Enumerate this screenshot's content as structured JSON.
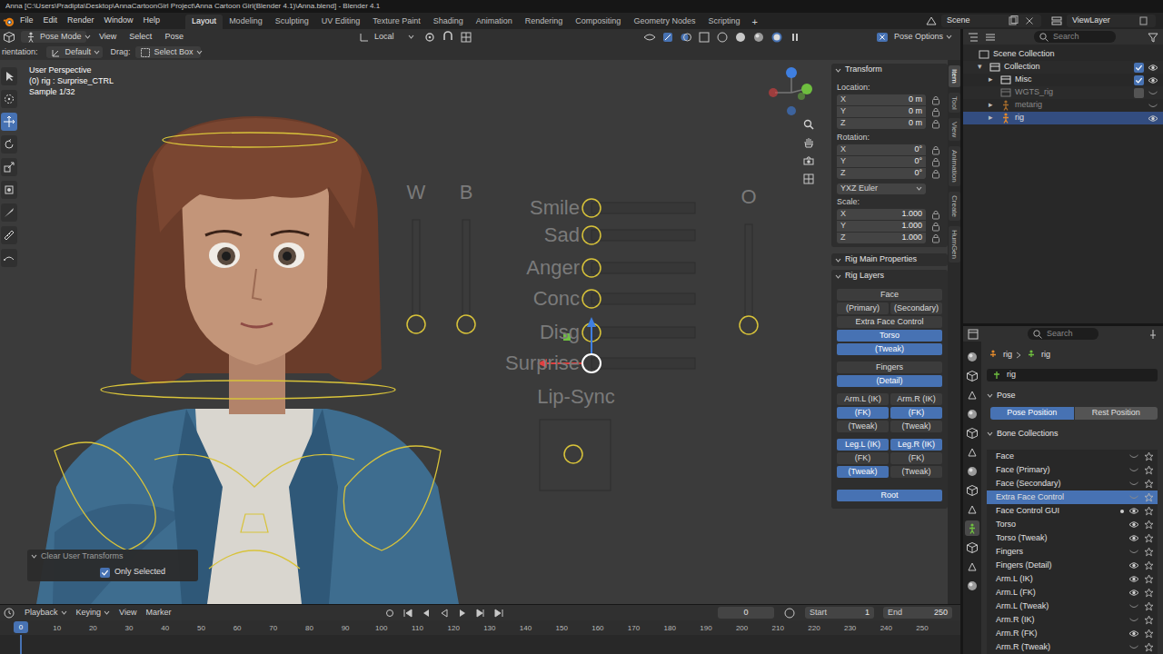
{
  "window": {
    "title": "Anna [C:\\Users\\Pradipta\\Desktop\\AnnaCartoonGirl Project\\Anna Cartoon Girl(Blender 4.1)\\Anna.blend] - Blender 4.1"
  },
  "menu": [
    "File",
    "Edit",
    "Render",
    "Window",
    "Help"
  ],
  "workspaces": [
    {
      "label": "Layout",
      "selected": true
    },
    {
      "label": "Modeling",
      "selected": false
    },
    {
      "label": "Sculpting",
      "selected": false
    },
    {
      "label": "UV Editing",
      "selected": false
    },
    {
      "label": "Texture Paint",
      "selected": false
    },
    {
      "label": "Shading",
      "selected": false
    },
    {
      "label": "Animation",
      "selected": false
    },
    {
      "label": "Rendering",
      "selected": false
    },
    {
      "label": "Compositing",
      "selected": false
    },
    {
      "label": "Geometry Nodes",
      "selected": false
    },
    {
      "label": "Scripting",
      "selected": false
    }
  ],
  "add_workspace": "+",
  "scene": "Scene",
  "view_layer": "ViewLayer",
  "viewport_header": {
    "mode": "Pose Mode",
    "menus": [
      "View",
      "Select",
      "Pose"
    ],
    "transform_space": "Local",
    "pose_options": "Pose Options"
  },
  "tool_settings": {
    "orientation_label": "rientation:",
    "orientation": "Default",
    "drag_label": "Drag:",
    "drag": "Select Box"
  },
  "viewport": {
    "info": [
      "User Perspective",
      "(0) rig : Surprise_CTRL",
      "Sample 1/32"
    ],
    "tools": [
      {
        "selected": false
      },
      {
        "selected": false
      },
      {
        "selected": true
      },
      {
        "selected": false
      },
      {
        "selected": false
      },
      {
        "selected": false
      },
      {
        "selected": false
      },
      {
        "selected": false
      },
      {
        "selected": false
      }
    ],
    "face_sliders": [
      {
        "label": "Smile",
        "selected": false
      },
      {
        "label": "Sad",
        "selected": false
      },
      {
        "label": "Anger",
        "selected": false
      },
      {
        "label": "Conc",
        "selected": false
      },
      {
        "label": "Disg",
        "selected": false
      },
      {
        "label": "Surprise",
        "selected": true
      }
    ],
    "lip_sync": "Lip-Sync",
    "vertical_controls": [
      {
        "label": "W"
      },
      {
        "label": "B"
      },
      {
        "label": "O"
      }
    ]
  },
  "operator_panel": {
    "title": "Clear User Transforms",
    "option": {
      "label": "Only Selected",
      "checked": true
    }
  },
  "sidebar": {
    "tabs": [
      {
        "label": "Item",
        "selected": true
      },
      {
        "label": "Tool",
        "selected": false
      },
      {
        "label": "View",
        "selected": false
      },
      {
        "label": "Animation",
        "selected": false
      },
      {
        "label": "Create",
        "selected": false
      },
      {
        "label": "HumGen",
        "selected": false
      }
    ],
    "transform": {
      "title": "Transform",
      "location_label": "Location:",
      "location": [
        {
          "axis": "X",
          "value": "0 m"
        },
        {
          "axis": "Y",
          "value": "0 m"
        },
        {
          "axis": "Z",
          "value": "0 m"
        }
      ],
      "rotation_label": "Rotation:",
      "rotation": [
        {
          "axis": "X",
          "value": "0°"
        },
        {
          "axis": "Y",
          "value": "0°"
        },
        {
          "axis": "Z",
          "value": "0°"
        }
      ],
      "rotation_mode": "YXZ Euler",
      "scale_label": "Scale:",
      "scale": [
        {
          "axis": "X",
          "value": "1.000"
        },
        {
          "axis": "Y",
          "value": "1.000"
        },
        {
          "axis": "Z",
          "value": "1.000"
        }
      ]
    },
    "rig_main_properties": "Rig Main Properties",
    "rig_layers": {
      "title": "Rig Layers",
      "groups": [
        [
          [
            {
              "label": "Face",
              "on": false
            }
          ],
          [
            {
              "label": "(Primary)",
              "on": false
            },
            {
              "label": "(Secondary)",
              "on": false
            }
          ],
          [
            {
              "label": "Extra Face Control",
              "on": false
            }
          ],
          [
            {
              "label": "Torso",
              "on": true
            }
          ],
          [
            {
              "label": "(Tweak)",
              "on": true
            }
          ]
        ],
        [
          [
            {
              "label": "Fingers",
              "on": false
            }
          ],
          [
            {
              "label": "(Detail)",
              "on": true
            }
          ]
        ],
        [
          [
            {
              "label": "Arm.L (IK)",
              "on": false
            },
            {
              "label": "Arm.R (IK)",
              "on": false
            }
          ],
          [
            {
              "label": "(FK)",
              "on": true
            },
            {
              "label": "(FK)",
              "on": true
            }
          ],
          [
            {
              "label": "(Tweak)",
              "on": false
            },
            {
              "label": "(Tweak)",
              "on": false
            }
          ]
        ],
        [
          [
            {
              "label": "Leg.L (IK)",
              "on": true
            },
            {
              "label": "Leg.R (IK)",
              "on": true
            }
          ],
          [
            {
              "label": "(FK)",
              "on": false
            },
            {
              "label": "(FK)",
              "on": false
            }
          ],
          [
            {
              "label": "(Tweak)",
              "on": true
            },
            {
              "label": "(Tweak)",
              "on": false
            }
          ]
        ],
        [
          [
            {
              "label": "Root",
              "on": true
            }
          ]
        ]
      ]
    }
  },
  "outliner": {
    "search": "Search",
    "items": [
      {
        "label": "Scene Collection",
        "kind": "scene",
        "depth": 0,
        "selected": false,
        "greyed": false
      },
      {
        "label": "Collection",
        "kind": "collection",
        "depth": 1,
        "arrow": "▾",
        "selected": false,
        "greyed": false,
        "checked": true,
        "visible": true
      },
      {
        "label": "Misc",
        "kind": "collection",
        "depth": 2,
        "arrow": "▸",
        "selected": false,
        "greyed": false,
        "checked": true,
        "visible": true
      },
      {
        "label": "WGTS_rig",
        "kind": "collection",
        "depth": 2,
        "selected": false,
        "greyed": true,
        "checked": false,
        "visible": false
      },
      {
        "label": "metarig",
        "kind": "object",
        "depth": 2,
        "arrow": "▸",
        "selected": false,
        "greyed": true,
        "visible": false
      },
      {
        "label": "rig",
        "kind": "object",
        "depth": 2,
        "arrow": "▸",
        "selected": true,
        "greyed": false,
        "visible": true
      }
    ]
  },
  "properties": {
    "search": "Search",
    "tab_icons": [
      {
        "selected": false
      },
      {
        "selected": false
      },
      {
        "selected": false
      },
      {
        "selected": false
      },
      {
        "selected": false
      },
      {
        "selected": false
      },
      {
        "selected": false
      },
      {
        "selected": false
      },
      {
        "selected": false
      },
      {
        "selected": true
      },
      {
        "selected": false
      },
      {
        "selected": false
      },
      {
        "selected": false
      }
    ],
    "breadcrumb": [
      "rig",
      "rig"
    ],
    "name": "rig",
    "pose": {
      "title": "Pose",
      "buttons": [
        {
          "label": "Pose Position",
          "selected": true
        },
        {
          "label": "Rest Position",
          "selected": false
        }
      ]
    },
    "bone_collections": {
      "title": "Bone Collections",
      "items": [
        {
          "label": "Face",
          "selected": false,
          "visible": false,
          "active": false
        },
        {
          "label": "Face (Primary)",
          "selected": false,
          "visible": false,
          "active": false
        },
        {
          "label": "Face (Secondary)",
          "selected": false,
          "visible": false,
          "active": false
        },
        {
          "label": "Extra Face Control",
          "selected": true,
          "visible": false,
          "active": false
        },
        {
          "label": "Face Control GUI",
          "selected": false,
          "visible": true,
          "active": true
        },
        {
          "label": "Torso",
          "selected": false,
          "visible": true,
          "active": false
        },
        {
          "label": "Torso (Tweak)",
          "selected": false,
          "visible": true,
          "active": false
        },
        {
          "label": "Fingers",
          "selected": false,
          "visible": false,
          "active": false
        },
        {
          "label": "Fingers (Detail)",
          "selected": false,
          "visible": true,
          "active": false
        },
        {
          "label": "Arm.L (IK)",
          "selected": false,
          "visible": true,
          "active": false
        },
        {
          "label": "Arm.L (FK)",
          "selected": false,
          "visible": true,
          "active": false
        },
        {
          "label": "Arm.L (Tweak)",
          "selected": false,
          "visible": false,
          "active": false
        },
        {
          "label": "Arm.R (IK)",
          "selected": false,
          "visible": false,
          "active": false
        },
        {
          "label": "Arm.R (FK)",
          "selected": false,
          "visible": true,
          "active": false
        },
        {
          "label": "Arm.R (Tweak)",
          "selected": false,
          "visible": false,
          "active": false
        }
      ]
    }
  },
  "timeline": {
    "menus": [
      "Playback",
      "Keying",
      "View",
      "Marker"
    ],
    "playhead": "0",
    "frame": "0",
    "start_label": "Start",
    "start": "1",
    "end_label": "End",
    "end": "250",
    "ticks": [
      "10",
      "20",
      "30",
      "40",
      "50",
      "60",
      "70",
      "80",
      "90",
      "100",
      "110",
      "120",
      "130",
      "140",
      "150",
      "160",
      "170",
      "180",
      "190",
      "200",
      "210",
      "220",
      "230",
      "240",
      "250"
    ]
  }
}
